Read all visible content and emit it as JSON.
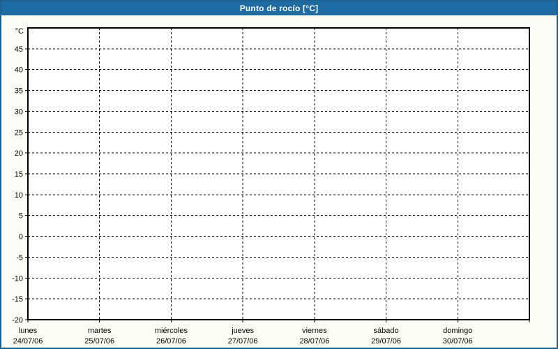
{
  "header": {
    "title": "Punto de rocío [°C]"
  },
  "colors": {
    "header_bg": "#1e6ba3",
    "header_text": "#ffffff",
    "page_border": "#1e628f",
    "page_bg": "#fdfdf8",
    "plot_bg": "#ffffff",
    "grid_color": "#000000",
    "axis_color": "#000000",
    "label_color": "#000000"
  },
  "chart_data": {
    "type": "line",
    "title": "Punto de rocío [°C]",
    "ylabel": "°C",
    "ylim": [
      -20,
      50
    ],
    "y_axis": {
      "unit_label": "°C",
      "min": -20,
      "max": 50,
      "tick_step": 5,
      "ticks": [
        45,
        40,
        35,
        30,
        25,
        20,
        15,
        10,
        5,
        0,
        -5,
        -10,
        -15,
        -20
      ]
    },
    "x_axis": {
      "days": [
        {
          "name": "lunes",
          "date": "24/07/06"
        },
        {
          "name": "martes",
          "date": "25/07/06"
        },
        {
          "name": "miércoles",
          "date": "26/07/06"
        },
        {
          "name": "jueves",
          "date": "27/07/06"
        },
        {
          "name": "viernes",
          "date": "28/07/06"
        },
        {
          "name": "sábado",
          "date": "29/07/06"
        },
        {
          "name": "domingo",
          "date": "30/07/06"
        }
      ]
    },
    "grid": "dashed",
    "legend": "none",
    "series": []
  }
}
